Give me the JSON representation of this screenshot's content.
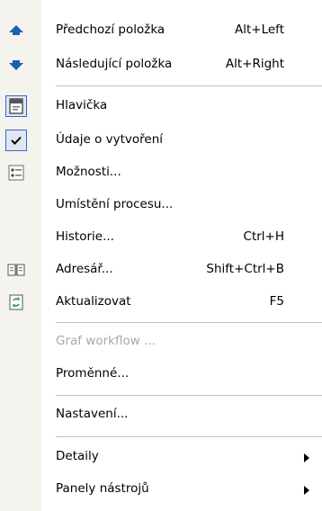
{
  "menu": {
    "items": [
      {
        "label": "Předchozí položka",
        "shortcut": "Alt+Left",
        "icon": "arrow-up-icon"
      },
      {
        "label": "Následující položka",
        "shortcut": "Alt+Right",
        "icon": "arrow-down-icon"
      },
      {
        "label": "Hlavička",
        "shortcut": "",
        "icon": "header-icon",
        "state": "selected"
      },
      {
        "label": "Údaje o vytvoření",
        "shortcut": "",
        "icon": "checkmark-icon",
        "state": "checked"
      },
      {
        "label": "Možnosti...",
        "shortcut": "",
        "icon": "options-icon"
      },
      {
        "label": "Umístění procesu...",
        "shortcut": "",
        "icon": ""
      },
      {
        "label": "Historie...",
        "shortcut": "Ctrl+H",
        "icon": ""
      },
      {
        "label": "Adresář...",
        "shortcut": "Shift+Ctrl+B",
        "icon": "address-book-icon"
      },
      {
        "label": "Aktualizovat",
        "shortcut": "F5",
        "icon": "refresh-icon"
      },
      {
        "label": "Graf workflow ...",
        "shortcut": "",
        "icon": "",
        "state": "disabled"
      },
      {
        "label": "Proměnné...",
        "shortcut": "",
        "icon": ""
      },
      {
        "label": "Nastavení...",
        "shortcut": "",
        "icon": ""
      },
      {
        "label": "Detaily",
        "shortcut": "",
        "icon": "",
        "submenu": true
      },
      {
        "label": "Panely nástrojů",
        "shortcut": "",
        "icon": "",
        "submenu": true
      }
    ]
  },
  "colors": {
    "gutter": "#f4f3ee",
    "arrow_blue": "#1c5fb8",
    "disabled_text": "#a7a6aa",
    "check_border": "#316ac5"
  }
}
